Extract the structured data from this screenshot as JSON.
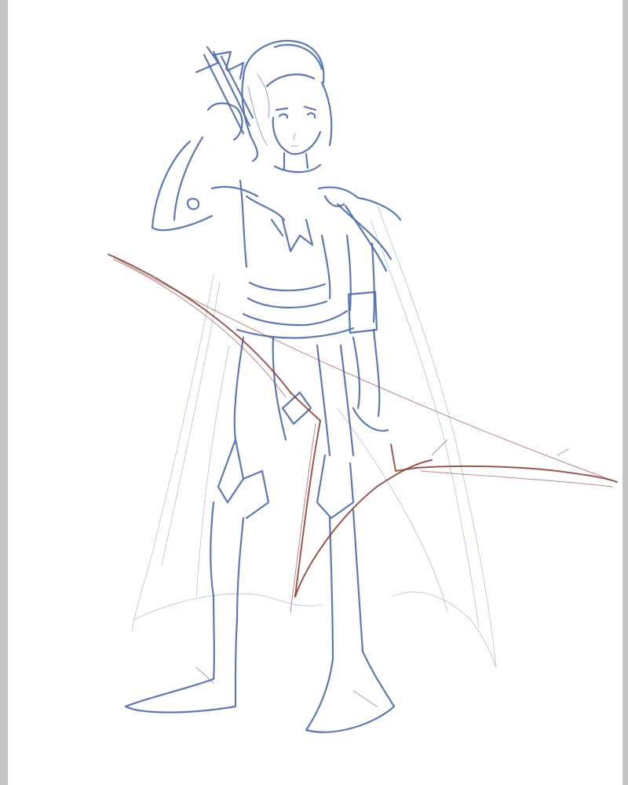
{
  "canvas": {
    "background_color": "#ffffff",
    "margin_color": "#c4c4c4"
  },
  "sketch": {
    "lines_main_color": "#4d6aa8",
    "lines_faint_color": "#7f96c6",
    "bow_color": "#8a3a30",
    "subject_parts": [
      "hair-and-face",
      "armor-torso",
      "cape",
      "raised-arm-with-arrows",
      "legs-and-boots",
      "longbow"
    ]
  }
}
